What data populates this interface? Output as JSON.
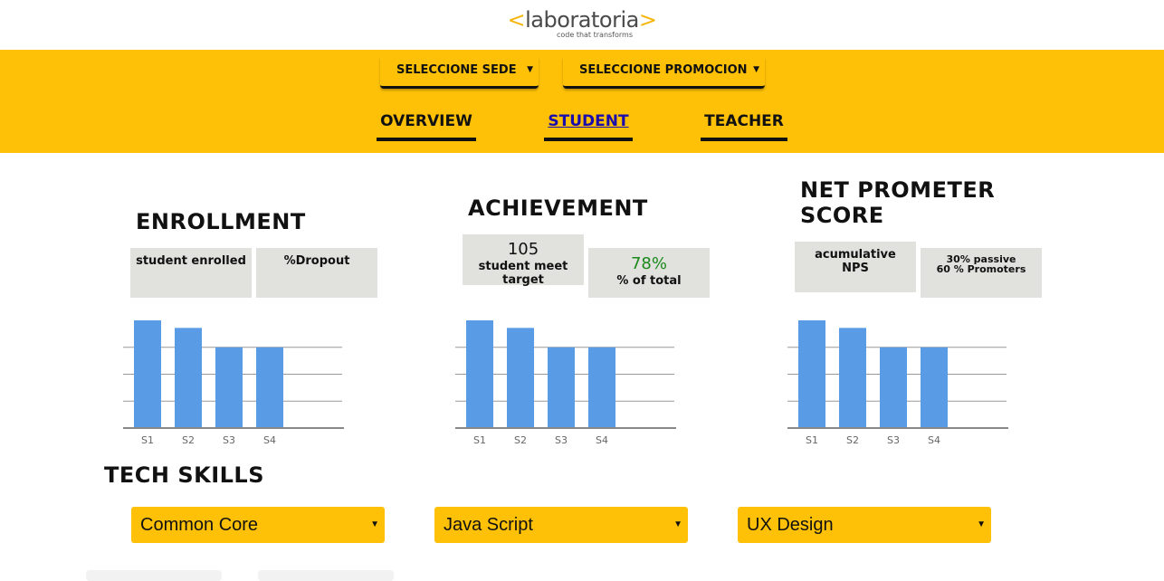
{
  "logo": {
    "left_bracket": "<",
    "name": "laboratoria",
    "right_bracket": ">",
    "tagline": "code that transforms"
  },
  "filters": {
    "sede_label": "SELECCIONE SEDE",
    "promocion_label": "SELECCIONE PROMOCION",
    "arrow": "▼"
  },
  "nav": {
    "overview": "OVERVIEW",
    "student": "STUDENT",
    "teacher": "TEACHER",
    "active": "student"
  },
  "enrollment": {
    "title": "ENROLLMENT",
    "enrolled_label": "student enrolled",
    "dropout_label": "%Dropout"
  },
  "achievement": {
    "title": "ACHIEVEMENT",
    "meet_value": "105",
    "meet_label_1": "student meet",
    "meet_label_2": "target",
    "pct_value": "78%",
    "pct_label": "% of total"
  },
  "nps": {
    "title_1": "NET PROMETER",
    "title_2": "SCORE",
    "cumulative_label_1": "acumulative",
    "cumulative_label_2": "NPS",
    "breakdown_1": "30% passive",
    "breakdown_2": "60 % Promoters"
  },
  "chart_data": [
    {
      "type": "bar",
      "categories": [
        "S1",
        "S2",
        "S3",
        "S4"
      ],
      "values": [
        100,
        93,
        75,
        75
      ],
      "ylim": [
        0,
        100
      ],
      "grid": true,
      "color": "#5a9be6"
    },
    {
      "type": "bar",
      "categories": [
        "S1",
        "S2",
        "S3",
        "S4"
      ],
      "values": [
        100,
        93,
        75,
        75
      ],
      "ylim": [
        0,
        100
      ],
      "grid": true,
      "color": "#5a9be6"
    },
    {
      "type": "bar",
      "categories": [
        "S1",
        "S2",
        "S3",
        "S4"
      ],
      "values": [
        100,
        93,
        75,
        75
      ],
      "ylim": [
        0,
        100
      ],
      "grid": true,
      "color": "#5a9be6"
    }
  ],
  "tech_skills": {
    "title": "TECH SKILLS",
    "selects": [
      "Common Core",
      "Java Script",
      "UX Design"
    ],
    "arrow": "▼"
  },
  "colors": {
    "accent": "#fec107",
    "bar": "#5a9be6",
    "box": "#e1e1de",
    "positive": "#1a8a1a"
  }
}
